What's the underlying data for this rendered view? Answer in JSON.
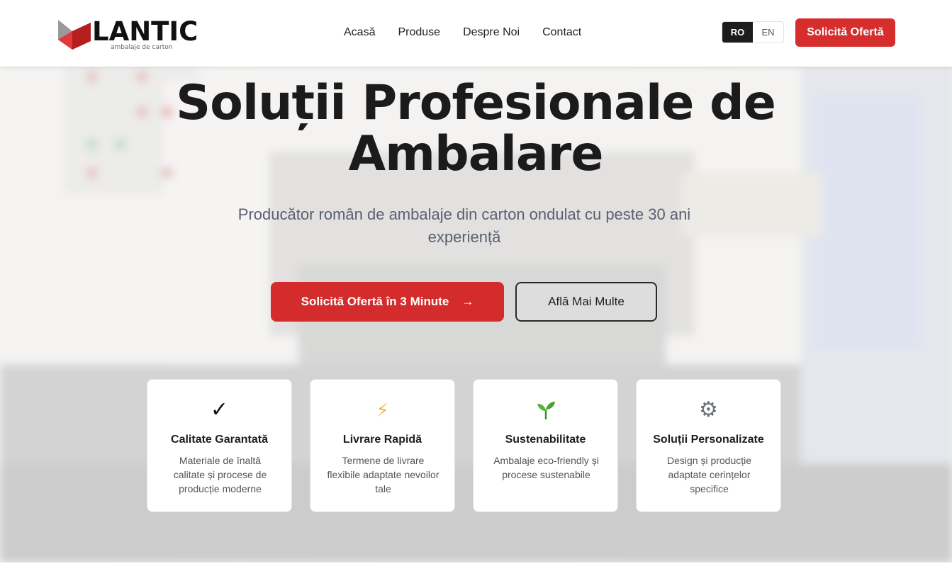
{
  "brand": {
    "name": "LANTIC",
    "tagline": "ambalaje de carton",
    "accent_color": "#d62d2d",
    "mark_icon": "logo-mark-icon"
  },
  "nav": {
    "items": [
      "Acasă",
      "Produse",
      "Despre Noi",
      "Contact"
    ]
  },
  "language": {
    "options": [
      "RO",
      "EN"
    ],
    "selected": "RO"
  },
  "header_cta": "Solicită Ofertă",
  "hero": {
    "title": "Soluții Profesionale de Ambalare",
    "subtitle": "Producător român de ambalaje din carton ondulat cu peste 30 ani experiență",
    "primary_button": "Solicită Ofertă în 3 Minute",
    "primary_button_icon": "arrow-right-icon",
    "secondary_button": "Află Mai Multe"
  },
  "features": [
    {
      "icon": "check-icon",
      "glyph": "✓",
      "title": "Calitate Garantată",
      "desc": "Materiale de înaltă calitate și procese de producție moderne"
    },
    {
      "icon": "lightning-icon",
      "glyph": "⚡",
      "title": "Livrare Rapidă",
      "desc": "Termene de livrare flexibile adaptate nevoilor tale"
    },
    {
      "icon": "seedling-icon",
      "glyph": "🌱",
      "title": "Sustenabilitate",
      "desc": "Ambalaje eco-friendly și procese sustenabile"
    },
    {
      "icon": "gear-icon",
      "glyph": "⚙",
      "title": "Soluții Personalizate",
      "desc": "Design și producție adaptate cerințelor specifice"
    }
  ]
}
